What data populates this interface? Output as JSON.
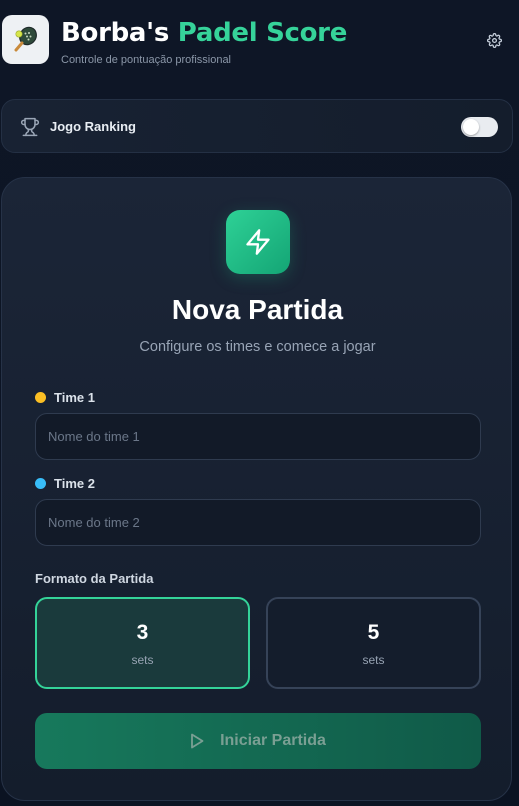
{
  "header": {
    "title_main": "Borba's",
    "title_accent": "Padel Score",
    "subtitle": "Controle de pontuação profissional"
  },
  "ranking": {
    "label": "Jogo Ranking",
    "toggle_on": false
  },
  "card": {
    "title": "Nova Partida",
    "subtitle": "Configure os times e comece a jogar",
    "team1": {
      "label": "Time 1",
      "placeholder": "Nome do time 1",
      "value": "",
      "color": "#fbbf24"
    },
    "team2": {
      "label": "Time 2",
      "placeholder": "Nome do time 2",
      "value": "",
      "color": "#38bdf8"
    },
    "format": {
      "label": "Formato da Partida",
      "options": [
        {
          "value": "3",
          "unit": "sets",
          "selected": true
        },
        {
          "value": "5",
          "unit": "sets",
          "selected": false
        }
      ]
    },
    "start_button": "Iniciar Partida"
  },
  "colors": {
    "accent": "#34d399",
    "background": "#0d1524",
    "card": "#1b2537"
  },
  "icons": {
    "logo": "padel-racket-icon",
    "settings": "gear-icon",
    "ranking": "trophy-icon",
    "hero": "lightning-bolt-icon",
    "start": "play-icon"
  }
}
